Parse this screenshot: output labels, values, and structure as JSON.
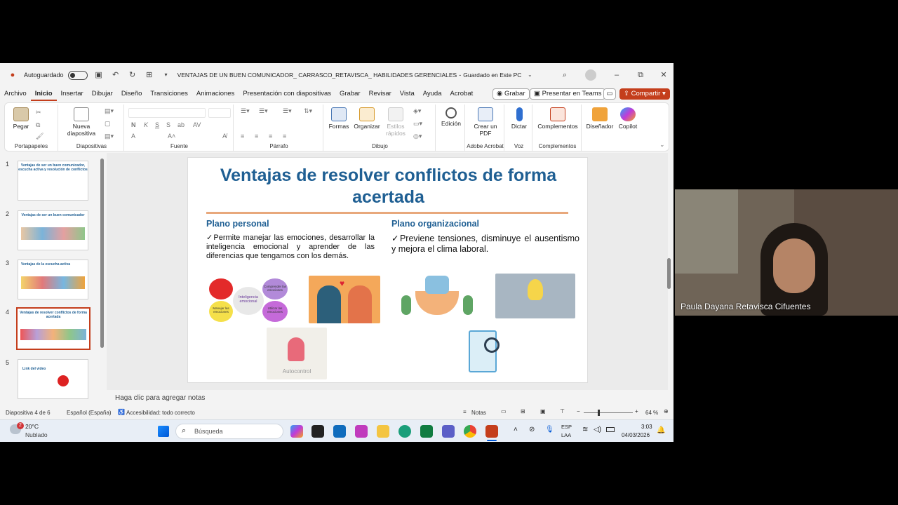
{
  "window": {
    "autosave_label": "Autoguardado",
    "doc_title": "VENTAJAS DE UN BUEN COMUNICADOR_ CARRASCO_RETAVISCA_ HABILIDADES GERENCIALES",
    "saved_status": "Guardado en Este PC"
  },
  "menu": [
    "Archivo",
    "Inicio",
    "Insertar",
    "Dibujar",
    "Diseño",
    "Transiciones",
    "Animaciones",
    "Presentación con diapositivas",
    "Grabar",
    "Revisar",
    "Vista",
    "Ayuda",
    "Acrobat"
  ],
  "menu_right": {
    "record": "Grabar",
    "present_teams": "Presentar en Teams",
    "share": "Compartir"
  },
  "ribbon": {
    "paste": "Pegar",
    "clipboard_group": "Portapapeles",
    "new_slide": "Nueva diapositiva",
    "slides_group": "Diapositivas",
    "font_group": "Fuente",
    "paragraph_group": "Párrafo",
    "shapes": "Formas",
    "arrange": "Organizar",
    "quick_styles": "Estilos rápidos",
    "drawing_group": "Dibujo",
    "editing": "Edición",
    "create_pdf": "Crear un PDF",
    "acrobat_group": "Adobe Acrobat",
    "dictate": "Dictar",
    "voice_group": "Voz",
    "addins": "Complementos",
    "addins_group": "Complementos",
    "designer": "Diseñador",
    "copilot": "Copilot"
  },
  "thumbnails": [
    {
      "num": "1",
      "title": "Ventajas de ser un buen comunicador, escucha activa y resolución de conflictos"
    },
    {
      "num": "2",
      "title": "Ventajas de ser un buen comunicador"
    },
    {
      "num": "3",
      "title": "Ventajas de la escucha activa"
    },
    {
      "num": "4",
      "title": "Ventajas de resolver conflictos de forma acertada"
    },
    {
      "num": "5",
      "title": "Link del video"
    }
  ],
  "slide": {
    "title": "Ventajas de resolver conflictos de forma acertada",
    "left_heading": "Plano personal",
    "left_text": "✓Permite manejar las emociones, desarrollar la inteligencia emocional y aprender de las diferencias que tengamos con los demás.",
    "right_heading": "Plano organizacional",
    "right_text": "✓Previene tensiones, disminuye el ausentismo y mejora el clima laboral.",
    "img_emotions_labels": [
      "Inteligencia emocional",
      "Manejar las emociones",
      "Utilizar las emociones",
      "Comprender las emociones"
    ],
    "img_autocontrol_label": "Autocontrol"
  },
  "notes_placeholder": "Haga clic para agregar notas",
  "status": {
    "slide_count": "Diapositiva 4 de 6",
    "language": "Español (España)",
    "accessibility": "Accesibilidad: todo correcto",
    "notes": "Notas",
    "zoom": "64 %"
  },
  "taskbar": {
    "weather_temp": "20°C",
    "weather_desc": "Nublado",
    "weather_badge": "2",
    "search": "Búsqueda",
    "lang1": "ESP",
    "lang2": "LAA",
    "time": "3:03",
    "date": "04/03/2026"
  },
  "webcam": {
    "name": "Paula Dayana Retavisca Cifuentes"
  },
  "colors": {
    "accent": "#c43e1c",
    "title_blue": "#1f5f93",
    "line": "#e8a87c"
  }
}
